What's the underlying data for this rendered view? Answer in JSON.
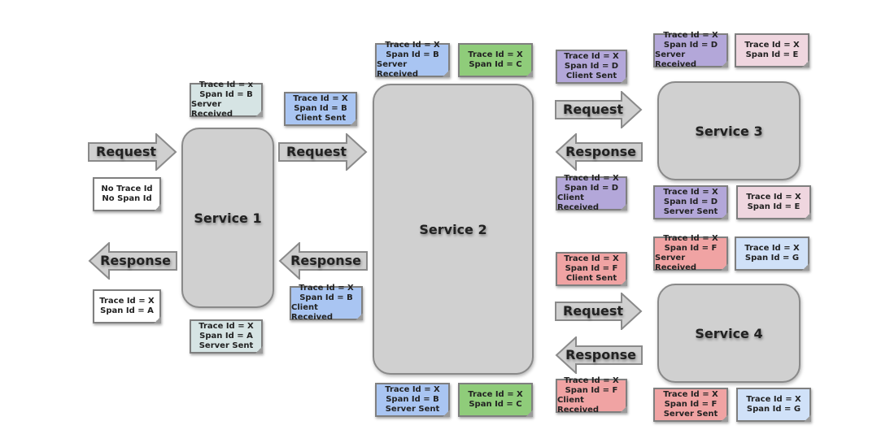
{
  "colors": {
    "teal": "#d6e4e4",
    "blue": "#a9c5f2",
    "green": "#8fcc7a",
    "purple": "#b3a7d9",
    "pink": "#efd6df",
    "red": "#f0a3a3",
    "lightblue": "#d0e1f8",
    "white": "#ffffff",
    "service": "#d0d0d0"
  },
  "services": [
    "Service 1",
    "Service 2",
    "Service 3",
    "Service 4"
  ],
  "arrows": {
    "request": "Request",
    "response": "Response"
  },
  "notes": [
    {
      "color": "teal",
      "lines": [
        "Trace Id = x",
        "Span Id = B",
        "Server Received"
      ]
    },
    {
      "color": "white",
      "lines": [
        "No Trace Id",
        "No Span Id"
      ]
    },
    {
      "color": "white",
      "lines": [
        "Trace Id = X",
        "Span Id = A"
      ]
    },
    {
      "color": "teal",
      "lines": [
        "Trace Id = X",
        "Span Id = A",
        "Server Sent"
      ]
    },
    {
      "color": "blue",
      "lines": [
        "Trace Id = X",
        "Span Id = B",
        "Client Sent"
      ]
    },
    {
      "color": "blue",
      "lines": [
        "Trace Id = X",
        "Span Id = B",
        "Client Received"
      ]
    },
    {
      "color": "blue",
      "lines": [
        "Trace Id = X",
        "Span Id = B",
        "Server Received"
      ]
    },
    {
      "color": "green",
      "lines": [
        "Trace Id = X",
        "Span Id = C"
      ]
    },
    {
      "color": "blue",
      "lines": [
        "Trace Id = X",
        "Span Id = B",
        "Server Sent"
      ]
    },
    {
      "color": "green",
      "lines": [
        "Trace Id = X",
        "Span Id = C"
      ]
    },
    {
      "color": "purple",
      "lines": [
        "Trace Id = X",
        "Span Id = D",
        "Client Sent"
      ]
    },
    {
      "color": "purple",
      "lines": [
        "Trace Id = X",
        "Span Id = D",
        "Server Received"
      ]
    },
    {
      "color": "pink",
      "lines": [
        "Trace Id = X",
        "Span Id = E"
      ]
    },
    {
      "color": "purple",
      "lines": [
        "Trace Id = X",
        "Span Id = D",
        "Client Received"
      ]
    },
    {
      "color": "purple",
      "lines": [
        "Trace Id = X",
        "Span Id = D",
        "Server Sent"
      ]
    },
    {
      "color": "pink",
      "lines": [
        "Trace Id = X",
        "Span Id = E"
      ]
    },
    {
      "color": "red",
      "lines": [
        "Trace Id = X",
        "Span Id = F",
        "Client Sent"
      ]
    },
    {
      "color": "red",
      "lines": [
        "Trace Id = X",
        "Span Id = F",
        "Server Received"
      ]
    },
    {
      "color": "lightblue",
      "lines": [
        "Trace Id = X",
        "Span Id = G"
      ]
    },
    {
      "color": "red",
      "lines": [
        "Trace Id = X",
        "Span Id = F",
        "Client Received"
      ]
    },
    {
      "color": "red",
      "lines": [
        "Trace Id = X",
        "Span Id = F",
        "Server Sent"
      ]
    },
    {
      "color": "lightblue",
      "lines": [
        "Trace Id = X",
        "Span Id = G"
      ]
    }
  ]
}
